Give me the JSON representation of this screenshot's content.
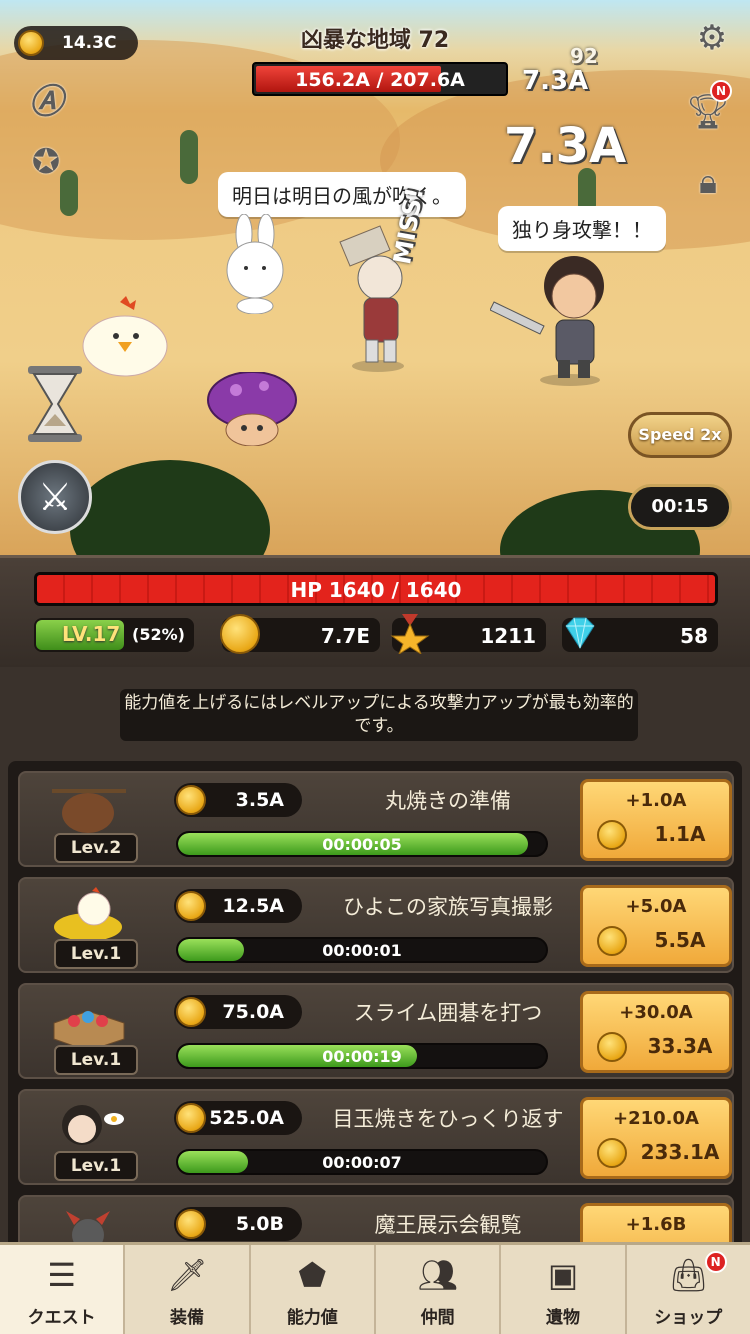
{
  "header": {
    "coins": "14.3C",
    "stage_name": "凶暴な地域",
    "stage_number": "72",
    "enemy_hp": "156.2A / 207.6A",
    "enemy_hp_fraction": 0.75,
    "damage_texts": [
      "7.3A",
      "92",
      "7.3A"
    ]
  },
  "scene": {
    "bubble_left": "明日は明日の風が吹く。",
    "bubble_right": "独り身攻撃！！",
    "miss_text": "MISS!",
    "speed_label": "Speed 2x",
    "timer": "00:15",
    "trophy_badge": "N"
  },
  "status": {
    "hp": "HP 1640 / 1640",
    "hp_fraction": 1.0,
    "level": "LV.17",
    "level_percent": "(52%)",
    "gold": "7.7E",
    "medals": "1211",
    "gems": "58"
  },
  "tip": "能力値を上げるにはレベルアップによる攻撃力アップが最も効率的です。",
  "quests": [
    {
      "level": "Lev.2",
      "cost": "3.5A",
      "name": "丸焼きの準備",
      "time": "00:00:05",
      "progress": 0.95,
      "gain": "+1.0A",
      "upgrade_cost": "1.1A"
    },
    {
      "level": "Lev.1",
      "cost": "12.5A",
      "name": "ひよこの家族写真撮影",
      "time": "00:00:01",
      "progress": 0.18,
      "gain": "+5.0A",
      "upgrade_cost": "5.5A"
    },
    {
      "level": "Lev.1",
      "cost": "75.0A",
      "name": "スライム囲碁を打つ",
      "time": "00:00:19",
      "progress": 0.65,
      "gain": "+30.0A",
      "upgrade_cost": "33.3A"
    },
    {
      "level": "Lev.1",
      "cost": "525.0A",
      "name": "目玉焼きをひっくり返す",
      "time": "00:00:07",
      "progress": 0.19,
      "gain": "+210.0A",
      "upgrade_cost": "233.1A"
    },
    {
      "level": "",
      "cost": "5.0B",
      "name": "魔王展示会観覧",
      "time": "",
      "progress": 0,
      "gain": "+1.6B",
      "upgrade_cost": ""
    }
  ],
  "tabs": [
    {
      "label": "クエスト",
      "icon": "scroll-icon"
    },
    {
      "label": "装備",
      "icon": "equipment-icon"
    },
    {
      "label": "能力値",
      "icon": "stats-icon"
    },
    {
      "label": "仲間",
      "icon": "party-icon"
    },
    {
      "label": "遺物",
      "icon": "chest-icon"
    },
    {
      "label": "ショップ",
      "icon": "shop-bag-icon"
    }
  ],
  "shop_badge": "N",
  "colors": {
    "hp_red": "#e3231c",
    "progress_green": "#3d9a1c",
    "button_gold": "#f0a93a",
    "gem_cyan": "#3fd0e8"
  }
}
